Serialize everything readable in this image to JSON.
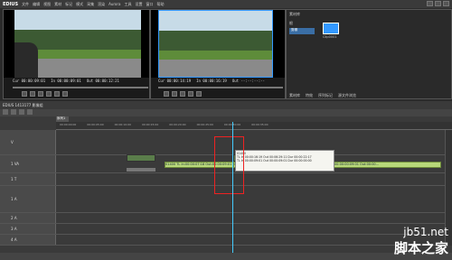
{
  "app": {
    "name": "EDIUS",
    "menus": [
      "文件",
      "编辑",
      "视图",
      "素材",
      "标记",
      "模式",
      "采集",
      "渲染",
      "Aurora",
      "工具",
      "设置",
      "窗口",
      "帮助"
    ]
  },
  "player": {
    "tc_cur": "Cur 00:00:09:01",
    "tc_in": "In 00:00:09:01",
    "tc_out": "Out 00:00:12:21"
  },
  "recorder": {
    "tc_cur": "Cur 00:00:14:19",
    "tc_in": "In 00:00:16:19",
    "tc_out": "Out --:--:--:--"
  },
  "bin": {
    "title": "素材库",
    "folder_label": "根",
    "clip_label": "Clip0001",
    "tabs": [
      "素材库",
      "特效",
      "序列标记",
      "源文件浏览"
    ],
    "clip_title": "剪辑"
  },
  "timeline": {
    "project": "EDIUS 1413177 影像组",
    "seq_tab": "序列1",
    "ruler": [
      "00:00:00:00",
      "00:00:05:00",
      "00:00:10:00",
      "00:00:15:00",
      "00:00:20:00",
      "00:00:25:00",
      "00:00:30:00",
      "00:00:35:00",
      "00:00:40:00",
      "00:00:45:00"
    ],
    "tracks": [
      {
        "name": "V"
      },
      {
        "name": "1 VA"
      },
      {
        "name": "1 T"
      },
      {
        "name": "1 A"
      },
      {
        "name": "2 A"
      },
      {
        "name": "3 A"
      },
      {
        "name": "4 A"
      }
    ],
    "clip_main": "01400 TL In:00:00:07:18 Out:00:00:09:01",
    "clip_right": "01400 TL In:00:00:16:19 Out:00:06:29:11 Dur:00:00:22:17 Src:00:00:00:09:01 Out:00:00...",
    "tooltip": [
      "01400",
      "TL  In 00:00:16:19 Out 00:06:29:11 Dur 00:00:22:17",
      "TL  In 00:00:09:01 Out 00:00:09:01 Dur 00:00:00:00"
    ]
  },
  "watermark": {
    "site": "jb51.net",
    "cn": "脚本之家"
  }
}
